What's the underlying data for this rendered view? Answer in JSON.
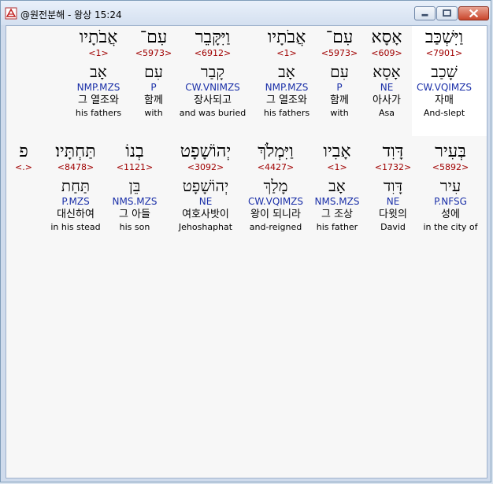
{
  "window": {
    "title": "@원전분해 - 왕상 15:24",
    "controls": {
      "minimize": "minimize-button",
      "maximize": "maximize-button",
      "close": "close-button"
    }
  },
  "rows": [
    {
      "words": [
        {
          "heb": "וַיִּשְׁכַּב",
          "strong": "<7901>",
          "lemma": "שָׁכַב",
          "morph": "CW.VQIMZS",
          "kor": "자매",
          "eng": "And-slept"
        },
        {
          "heb": "אָסָא",
          "strong": "<609>",
          "lemma": "אָסָא",
          "morph": "NE",
          "kor": "아사가",
          "eng": "Asa"
        },
        {
          "heb": "עִם־",
          "strong": "<5973>",
          "lemma": "עִם",
          "morph": "P",
          "kor": "함께",
          "eng": "with"
        },
        {
          "heb": "אֲבֹתָיו",
          "strong": "<1>",
          "lemma": "אָב",
          "morph": "NMP.MZS",
          "kor": "그 열조와",
          "eng": "his fathers"
        },
        {
          "heb": "וַיִּקָּבֵר",
          "strong": "<6912>",
          "lemma": "קָבַר",
          "morph": "CW.VNIMZS",
          "kor": "장사되고",
          "eng": "and was buried"
        },
        {
          "heb": "עִם־",
          "strong": "<5973>",
          "lemma": "עִם",
          "morph": "P",
          "kor": "함께",
          "eng": "with"
        },
        {
          "heb": "אֲבֹתָיו",
          "strong": "<1>",
          "lemma": "אָב",
          "morph": "NMP.MZS",
          "kor": "그 열조와",
          "eng": "his fathers"
        }
      ]
    },
    {
      "words": [
        {
          "heb": "בְּעִיר",
          "strong": "<5892>",
          "lemma": "עִיר",
          "morph": "P.NFSG",
          "kor": "성에",
          "eng": "in the city of"
        },
        {
          "heb": "דָּוִד",
          "strong": "<1732>",
          "lemma": "דָּוִד",
          "morph": "NE",
          "kor": "다윗의",
          "eng": "David"
        },
        {
          "heb": "אָבִיו",
          "strong": "<1>",
          "lemma": "אָב",
          "morph": "NMS.MZS",
          "kor": "그 조상",
          "eng": "his father"
        },
        {
          "heb": "וַיִּמְלֹךְ",
          "strong": "<4427>",
          "lemma": "מָלַךְ",
          "morph": "CW.VQIMZS",
          "kor": "왕이 되니라",
          "eng": "and-reigned"
        },
        {
          "heb": "יְהוֹשָׁפָט",
          "strong": "<3092>",
          "lemma": "יְהוֹשָׁפָט",
          "morph": "NE",
          "kor": "여호사밧이",
          "eng": "Jehoshaphat"
        },
        {
          "heb": "בְנוֹ",
          "strong": "<1121>",
          "lemma": "בֵּן",
          "morph": "NMS.MZS",
          "kor": "그 아들",
          "eng": "his son"
        },
        {
          "heb": "תַּחְתָּיו׃",
          "strong": "<8478>",
          "lemma": "תַּחַת",
          "morph": "P.MZS",
          "kor": "대신하여",
          "eng": "in his stead"
        },
        {
          "heb": "פ",
          "strong": "<.>",
          "lemma": "",
          "morph": "",
          "kor": "",
          "eng": ""
        }
      ]
    }
  ]
}
